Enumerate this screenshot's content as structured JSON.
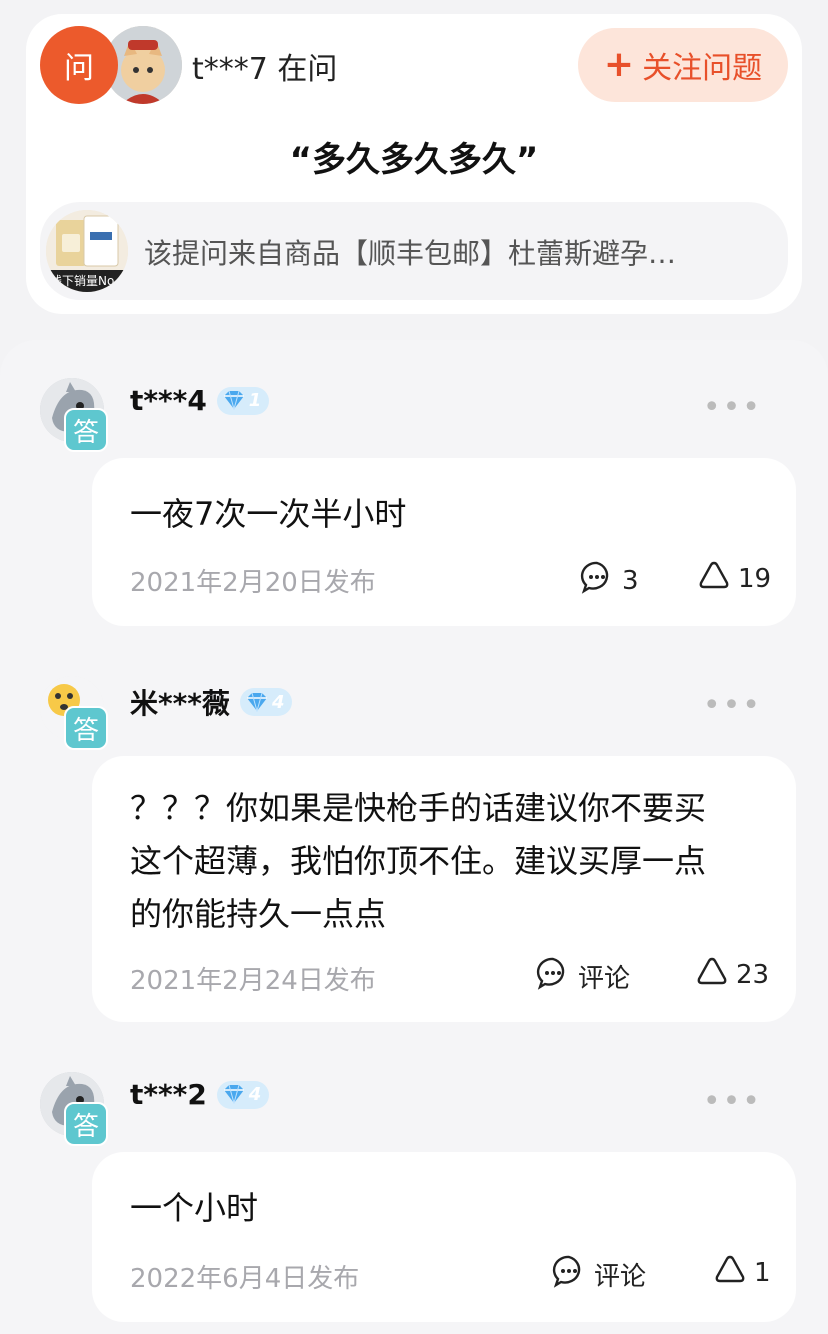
{
  "question": {
    "badge": "问",
    "asker": "t***7 在问",
    "follow_label": "关注问题",
    "title": "“多久多久多久”",
    "product_text": "该提问来自商品【顺丰包邮】杜蕾斯避孕…",
    "product_thumb_caption": "线下销量No"
  },
  "answers": [
    {
      "user": "t***4",
      "level": "1",
      "tag": "答",
      "more": "•••",
      "text_lines": [
        "一夜7次一次半小时"
      ],
      "date": "2021年2月20日发布",
      "comment": "3",
      "likes": "19"
    },
    {
      "user": "米***薇",
      "level": "4",
      "tag": "答",
      "more": "•••",
      "text_lines": [
        "？？？你如果是快枪手的话建议你不要买",
        "这个超薄，我怕你顶不住。建议买厚一点",
        "的你能持久一点点"
      ],
      "date": "2021年2月24日发布",
      "comment": "评论",
      "likes": "23"
    },
    {
      "user": "t***2",
      "level": "4",
      "tag": "答",
      "more": "•••",
      "text_lines": [
        "一个小时"
      ],
      "date": "2022年6月4日发布",
      "comment": "评论",
      "likes": "1"
    }
  ],
  "colors": {
    "accent": "#ec5a2c",
    "answer_tag": "#5ec7cf",
    "level_badge": "#d6ecfb"
  }
}
